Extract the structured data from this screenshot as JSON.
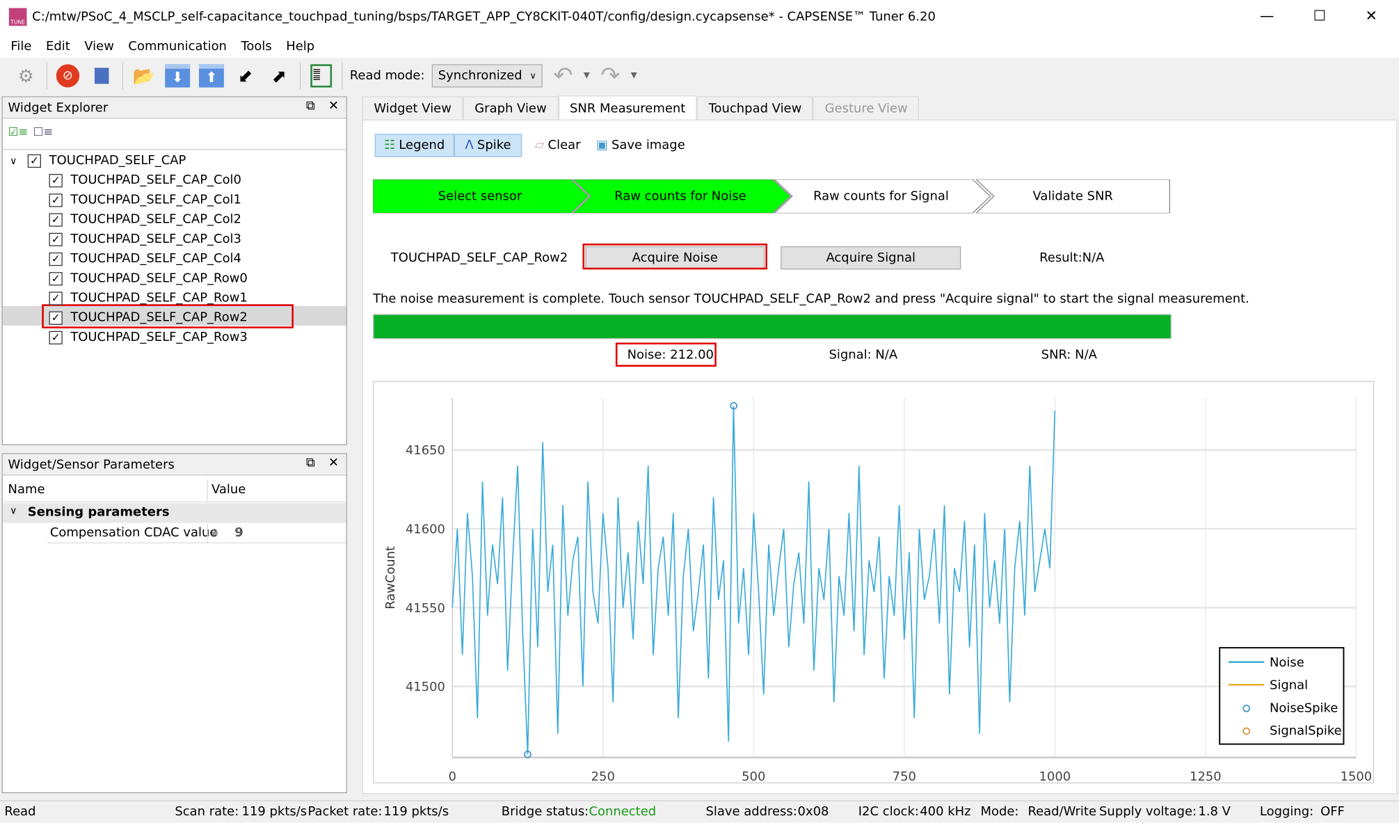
{
  "window": {
    "title": "C:/mtw/PSoC_4_MSCLP_self-capacitance_touchpad_tuning/bsps/TARGET_APP_CY8CKIT-040T/config/design.cycapsense* - CAPSENSE™ Tuner 6.20",
    "icon_text": "TUNE",
    "minimize": "—",
    "maximize": "☐",
    "close": "✕"
  },
  "menu": [
    "File",
    "Edit",
    "View",
    "Communication",
    "Tools",
    "Help"
  ],
  "toolbar": {
    "read_mode_label": "Read mode:",
    "read_mode_value": "Synchronized",
    "icons": [
      "gear-icon",
      "disconnect-icon",
      "stop-icon",
      "open-folder-icon",
      "read-from-device-icon",
      "write-to-device-icon",
      "import-icon",
      "export-icon",
      "log-icon",
      "undo-icon",
      "redo-icon"
    ]
  },
  "widget_explorer": {
    "title": "Widget Explorer",
    "root": "TOUCHPAD_SELF_CAP",
    "items": [
      "TOUCHPAD_SELF_CAP_Col0",
      "TOUCHPAD_SELF_CAP_Col1",
      "TOUCHPAD_SELF_CAP_Col2",
      "TOUCHPAD_SELF_CAP_Col3",
      "TOUCHPAD_SELF_CAP_Col4",
      "TOUCHPAD_SELF_CAP_Row0",
      "TOUCHPAD_SELF_CAP_Row1",
      "TOUCHPAD_SELF_CAP_Row2",
      "TOUCHPAD_SELF_CAP_Row3"
    ],
    "selected": "TOUCHPAD_SELF_CAP_Row2"
  },
  "params": {
    "title": "Widget/Sensor Parameters",
    "col_name": "Name",
    "col_value": "Value",
    "group": "Sensing parameters",
    "rows": [
      {
        "name": "Compensation CDAC value",
        "value": "9"
      }
    ]
  },
  "tabs": [
    {
      "label": "Widget View"
    },
    {
      "label": "Graph View"
    },
    {
      "label": "SNR Measurement",
      "active": true
    },
    {
      "label": "Touchpad View"
    },
    {
      "label": "Gesture View",
      "disabled": true
    }
  ],
  "snr": {
    "legend_btn": "Legend",
    "spike_btn": "Spike",
    "clear_btn": "Clear",
    "save_btn": "Save image",
    "steps": [
      {
        "label": "Select sensor",
        "done": true
      },
      {
        "label": "Raw counts for Noise",
        "done": true
      },
      {
        "label": "Raw counts for Signal",
        "done": false
      },
      {
        "label": "Validate SNR",
        "done": false
      }
    ],
    "sensor": "TOUCHPAD_SELF_CAP_Row2",
    "acquire_noise": "Acquire Noise",
    "acquire_signal": "Acquire Signal",
    "result": "Result:N/A",
    "message": "The noise measurement is complete. Touch sensor TOUCHPAD_SELF_CAP_Row2 and press \"Acquire signal\" to start the signal measurement.",
    "progress_percent": 100,
    "noise": "Noise:  212.00",
    "signal": "Signal:  N/A",
    "snr": "SNR:  N/A",
    "colors": {
      "step_done": "#00ff00",
      "progress": "#06b025"
    }
  },
  "chart_data": {
    "type": "line",
    "ylabel": "RawCount",
    "xlim": [
      0,
      1500
    ],
    "ylim": [
      41455,
      41683
    ],
    "x_ticks": [
      "0",
      "250",
      "500",
      "750",
      "1000",
      "1250",
      "1500"
    ],
    "y_ticks": [
      "41500",
      "41550",
      "41600",
      "41650"
    ],
    "grid": true,
    "legend_position": "bottom-right",
    "legend": [
      {
        "name": "Noise",
        "kind": "line",
        "color": "#3aaad8"
      },
      {
        "name": "Signal",
        "kind": "line",
        "color": "#e8b030"
      },
      {
        "name": "NoiseSpike",
        "kind": "marker",
        "color": "#3a8fc8"
      },
      {
        "name": "SignalSpike",
        "kind": "marker",
        "color": "#d89030"
      }
    ],
    "noise_x_range": [
      0,
      1000
    ],
    "noise_values": [
      41550,
      41600,
      41520,
      41610,
      41570,
      41480,
      41630,
      41545,
      41590,
      41565,
      41620,
      41510,
      41580,
      41640,
      41535,
      41457,
      41600,
      41525,
      41655,
      41560,
      41590,
      41470,
      41615,
      41545,
      41580,
      41595,
      41500,
      41630,
      41560,
      41540,
      41610,
      41575,
      41490,
      41620,
      41550,
      41585,
      41530,
      41605,
      41565,
      41640,
      41520,
      41575,
      41595,
      41545,
      41610,
      41480,
      41570,
      41600,
      41535,
      41560,
      41590,
      41505,
      41620,
      41555,
      41580,
      41465,
      41678,
      41540,
      41575,
      41520,
      41610,
      41560,
      41495,
      41590,
      41545,
      41575,
      41600,
      41525,
      41565,
      41585,
      41540,
      41630,
      41510,
      41575,
      41555,
      41600,
      41490,
      41570,
      41545,
      41610,
      41535,
      41640,
      41520,
      41580,
      41560,
      41595,
      41505,
      41570,
      41545,
      41615,
      41530,
      41585,
      41480,
      41600,
      41555,
      41570,
      41600,
      41540,
      41615,
      41495,
      41575,
      41560,
      41605,
      41525,
      41590,
      41470,
      41610,
      41550,
      41580,
      41540,
      41600,
      41490,
      41575,
      41605,
      41545,
      41640,
      41560,
      41580,
      41600,
      41575,
      41675
    ],
    "signal_values": [],
    "noise_spikes": [
      {
        "x": 125,
        "y": 41457
      },
      {
        "x": 467,
        "y": 41678
      }
    ],
    "signal_spikes": []
  },
  "status": {
    "state": "Read",
    "scan_rate_label": "Scan rate:",
    "scan_rate": "119 pkts/s",
    "packet_rate_label": "Packet rate:",
    "packet_rate": "119 pkts/s",
    "bridge_label": "Bridge status:",
    "bridge": "Connected",
    "slave_label": "Slave address:",
    "slave": "0x08",
    "i2c_label": "I2C clock:",
    "i2c": "400 kHz",
    "mode_label": "Mode:",
    "mode": "Read/Write",
    "supply_label": "Supply voltage:",
    "supply": "1.8 V",
    "logging_label": "Logging:",
    "logging": "OFF"
  }
}
